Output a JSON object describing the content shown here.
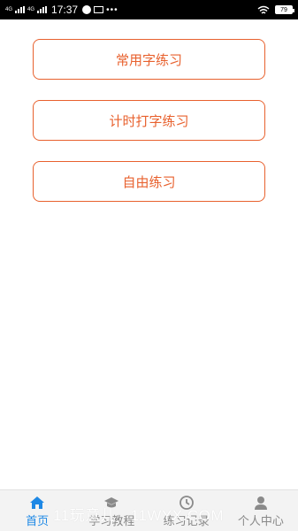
{
  "status_bar": {
    "network": "4G",
    "network_sub": "4G",
    "time": "17:37",
    "dots": "•••",
    "battery": "79"
  },
  "menu": {
    "items": [
      {
        "label": "常用字练习"
      },
      {
        "label": "计时打字练习"
      },
      {
        "label": "自由练习"
      }
    ]
  },
  "tabbar": {
    "tabs": [
      {
        "label": "首页",
        "icon": "home-icon",
        "active": true
      },
      {
        "label": "学习教程",
        "icon": "tutorial-icon",
        "active": false
      },
      {
        "label": "练习记录",
        "icon": "history-icon",
        "active": false
      },
      {
        "label": "个人中心",
        "icon": "user-icon",
        "active": false
      }
    ]
  },
  "colors": {
    "accent": "#e8612e",
    "tab_active": "#1e88e5",
    "tab_inactive": "#888888"
  },
  "watermark": "11玩意儿 · 11WYX.COM"
}
